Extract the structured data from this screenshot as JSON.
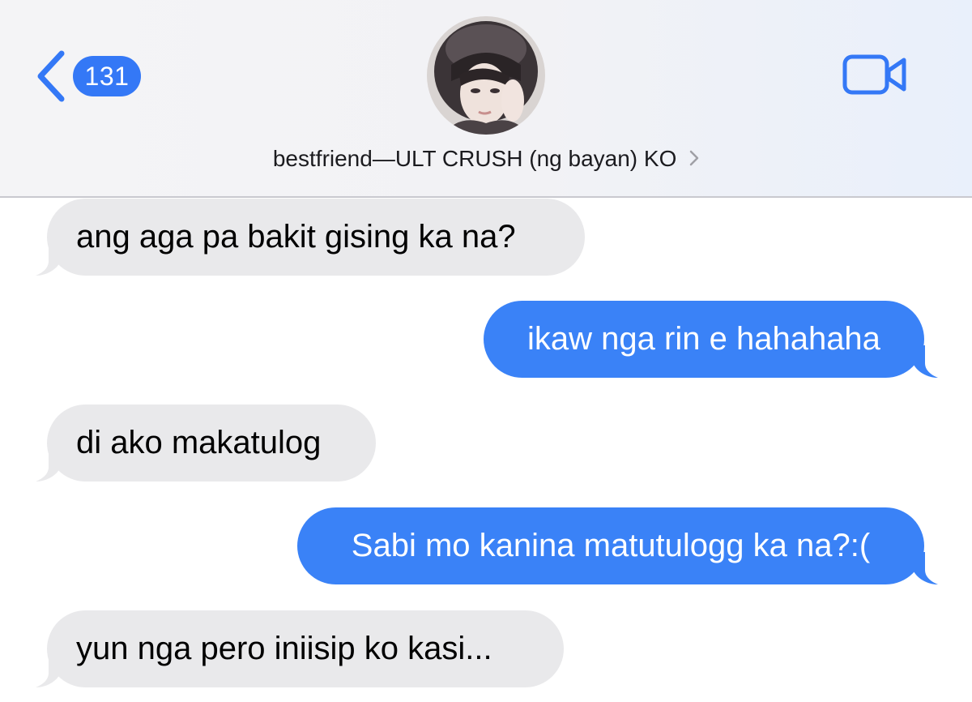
{
  "header": {
    "back_badge": "131",
    "contact_name": "bestfriend—ULT CRUSH (ng bayan) KO"
  },
  "colors": {
    "accent": "#3478f6",
    "outgoing_bubble": "#3a82f7",
    "incoming_bubble": "#e9e9eb"
  },
  "icons": {
    "back": "chevron-left-icon",
    "video": "video-camera-icon",
    "name_chevron": "chevron-right-icon"
  },
  "messages": [
    {
      "direction": "incoming",
      "text": "ang aga pa bakit gising ka na?"
    },
    {
      "direction": "outgoing",
      "text": "ikaw nga rin e hahahaha"
    },
    {
      "direction": "incoming",
      "text": "di ako makatulog"
    },
    {
      "direction": "outgoing",
      "text": "Sabi mo kanina matutulogg ka na?:("
    },
    {
      "direction": "incoming",
      "text": "yun nga pero iniisip ko kasi..."
    }
  ]
}
